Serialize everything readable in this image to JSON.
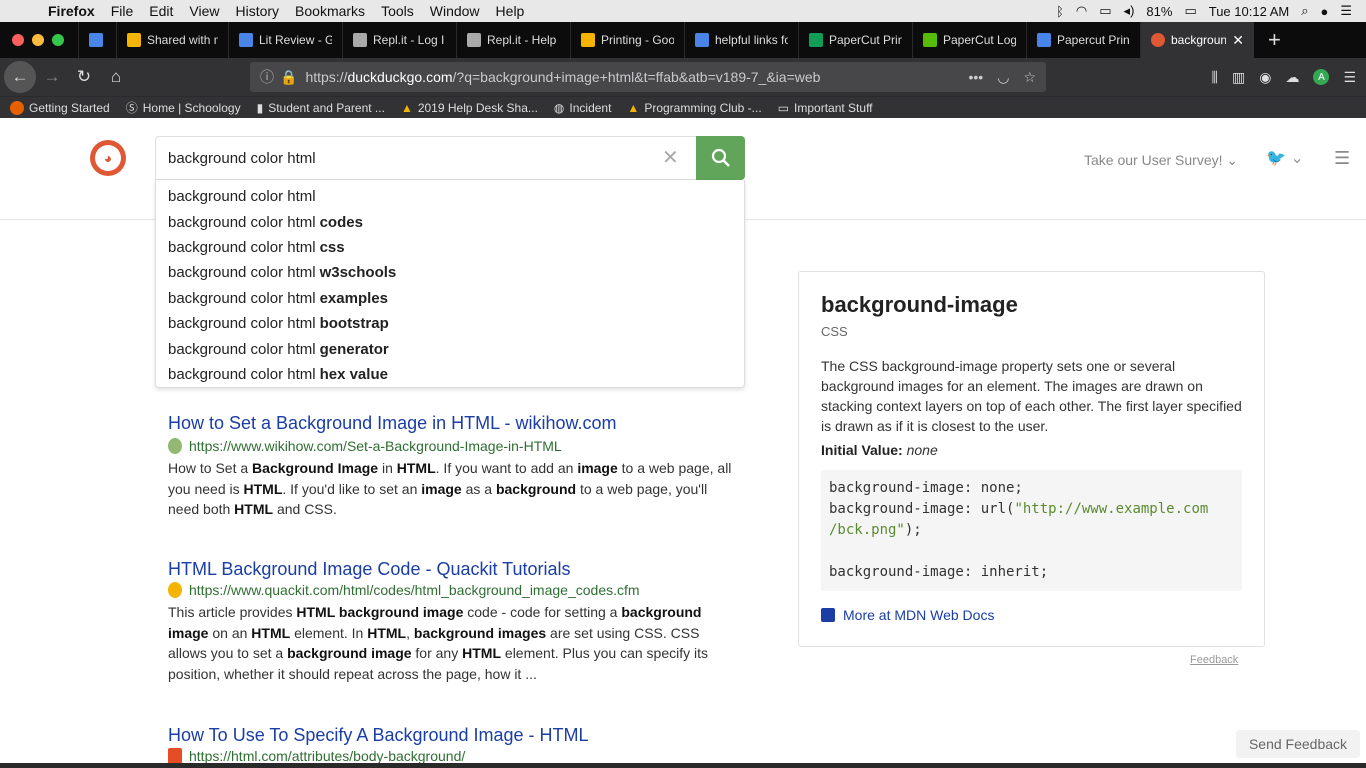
{
  "menubar": {
    "app": "Firefox",
    "items": [
      "File",
      "Edit",
      "View",
      "History",
      "Bookmarks",
      "Tools",
      "Window",
      "Help"
    ],
    "battery": "81%",
    "clock": "Tue 10:12 AM"
  },
  "tabs": [
    {
      "label": "",
      "color": "#4a86e8"
    },
    {
      "label": "Shared with m",
      "color": "#f4b400"
    },
    {
      "label": "Lit Review - G",
      "color": "#4a86e8"
    },
    {
      "label": "Repl.it - Log I",
      "color": "#aaaaaa"
    },
    {
      "label": "Repl.it - Help",
      "color": "#aaaaaa"
    },
    {
      "label": "Printing - Goo",
      "color": "#f4b400"
    },
    {
      "label": "helpful links fo",
      "color": "#4a86e8"
    },
    {
      "label": "PaperCut Prin",
      "color": "#0f9d58"
    },
    {
      "label": "PaperCut Log",
      "color": "#57bb00"
    },
    {
      "label": "Papercut Prin",
      "color": "#4a86e8"
    },
    {
      "label": "backgroun",
      "color": "#de5833"
    }
  ],
  "url": {
    "prefix": "https://",
    "host": "duckduckgo.com",
    "path": "/?q=background+image+html&t=ffab&atb=v189-7_&ia=web"
  },
  "bookmarks": [
    "Getting Started",
    "Home | Schoology",
    "Student and Parent ...",
    "2019 Help Desk Sha...",
    "Incident",
    "Programming Club -...",
    "Important Stuff"
  ],
  "search": {
    "query": "background color html",
    "survey": "Take our User Survey!"
  },
  "suggestions": [
    {
      "base": "background color html",
      "bold": ""
    },
    {
      "base": "background color html",
      "bold": "codes"
    },
    {
      "base": "background color html",
      "bold": "css"
    },
    {
      "base": "background color html",
      "bold": "w3schools"
    },
    {
      "base": "background color html",
      "bold": "examples"
    },
    {
      "base": "background color html",
      "bold": "bootstrap"
    },
    {
      "base": "background color html",
      "bold": "generator"
    },
    {
      "base": "background color html",
      "bold": "hex value"
    }
  ],
  "results": [
    {
      "title": "How to Set a Background Image in HTML - wikihow.com",
      "url": "https://www.wikihow.com/Set-a-Background-Image-in-HTML"
    },
    {
      "title": "HTML Background Image Code - Quackit Tutorials",
      "url": "https://www.quackit.com/html/codes/html_background_image_codes.cfm"
    },
    {
      "title": "How To Use To Specify A Background Image - HTML",
      "url": "https://html.com/attributes/body-background/"
    }
  ],
  "snip1": {
    "a": "How to Set a ",
    "b": "Background Image",
    "c": " in ",
    "d": "HTML",
    "e": ". If you want to add an ",
    "f": "image",
    "g": " to a web page, all you need is ",
    "h": "HTML",
    "i": ". If you'd like to set an ",
    "j": "image",
    "k": " as a ",
    "l": "background",
    "m": " to a web page, you'll need both ",
    "n": "HTML",
    "o": " and CSS."
  },
  "snip2": {
    "a": "This article provides ",
    "b": "HTML background image",
    "c": " code - code for setting a ",
    "d": "background image",
    "e": " on an ",
    "f": "HTML",
    "g": " element. In ",
    "h": "HTML",
    "i": ", ",
    "j": "background images",
    "k": " are set using CSS. CSS allows you to set a ",
    "l": "background image",
    "m": " for any ",
    "n": "HTML",
    "o": " element. Plus you can specify its position, whether it should repeat across the page, how it ..."
  },
  "ia": {
    "title": "background-image",
    "subtitle": "CSS",
    "description": "The CSS background-image property sets one or several background images for an element. The images are drawn on stacking context layers on top of each other. The first layer specified is drawn as if it is closest to the user.",
    "initial_label": "Initial Value:",
    "initial_value": "none",
    "code1": "background-image: none;",
    "code2a": "background-image: url(",
    "code2b": "\"http://www.example.com",
    "code3a": "/bck.png\"",
    "code3b": ");",
    "code4": "background-image: inherit;",
    "more": "More at MDN Web Docs",
    "feedback": "Feedback"
  },
  "send_feedback": "Send Feedback"
}
